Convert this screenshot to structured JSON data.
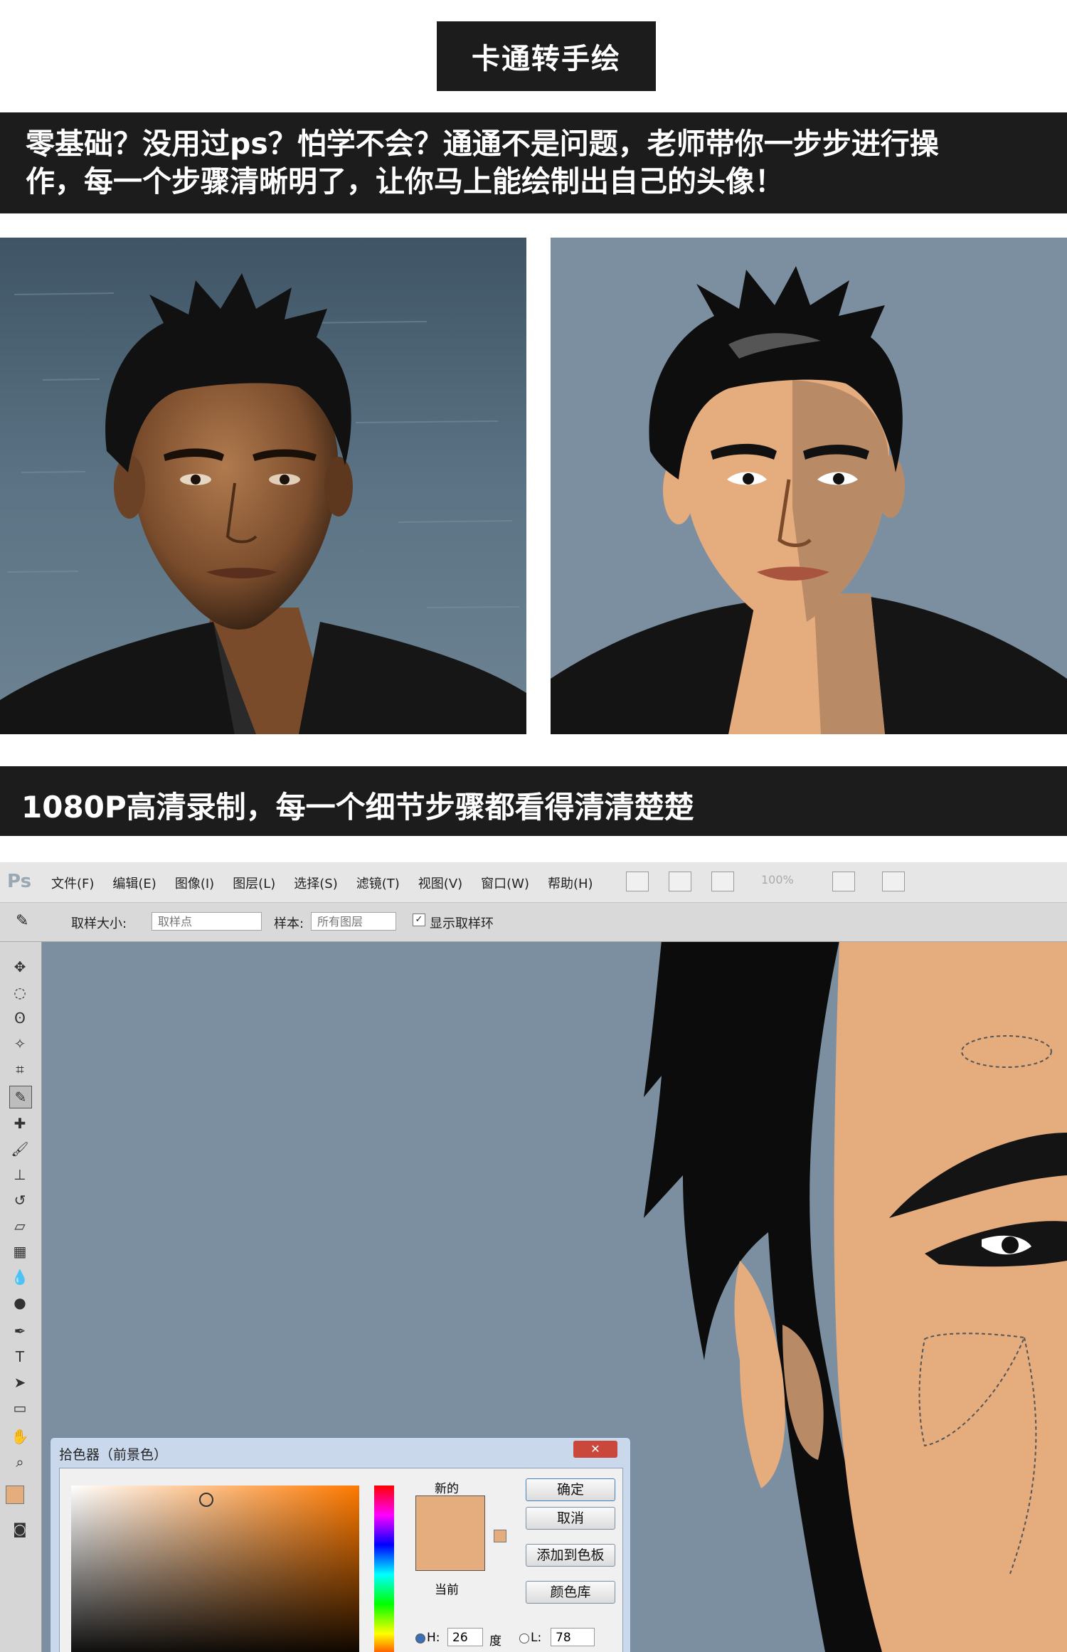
{
  "header": {
    "title": "卡通转手绘",
    "intro_line1": "零基础？没用过ps？怕学不会？通通不是问题，老师带你一步步进行操",
    "intro_line2": "作，每一个步骤清晰明了，让你马上能绘制出自己的头像！"
  },
  "section2": {
    "text": "1080P高清录制，每一个细节步骤都看得清清楚楚"
  },
  "photoshop": {
    "logo": "Ps",
    "menu": [
      "文件(F)",
      "编辑(E)",
      "图像(I)",
      "图层(L)",
      "选择(S)",
      "滤镜(T)",
      "视图(V)",
      "窗口(W)",
      "帮助(H)"
    ],
    "zoom": "100%",
    "options": {
      "sample_size_label": "取样大小:",
      "sample_size_value": "取样点",
      "sample_label": "样本:",
      "sample_value": "所有图层",
      "show_ring_label": "显示取样环"
    },
    "color_picker": {
      "title": "拾色器（前景色）",
      "new_label": "新的",
      "current_label": "当前",
      "ok": "确定",
      "cancel": "取消",
      "add_swatch": "添加到色板",
      "color_library": "颜色库",
      "h_label": "H:",
      "h_value": "26",
      "h_unit": "度",
      "l_label": "L:",
      "l_value": "78"
    }
  },
  "colors": {
    "band": "#1c1c1c",
    "canvas_bg": "#7b8fa1",
    "skin": "#e5ac7d",
    "skin_shadow": "#b98a66"
  }
}
